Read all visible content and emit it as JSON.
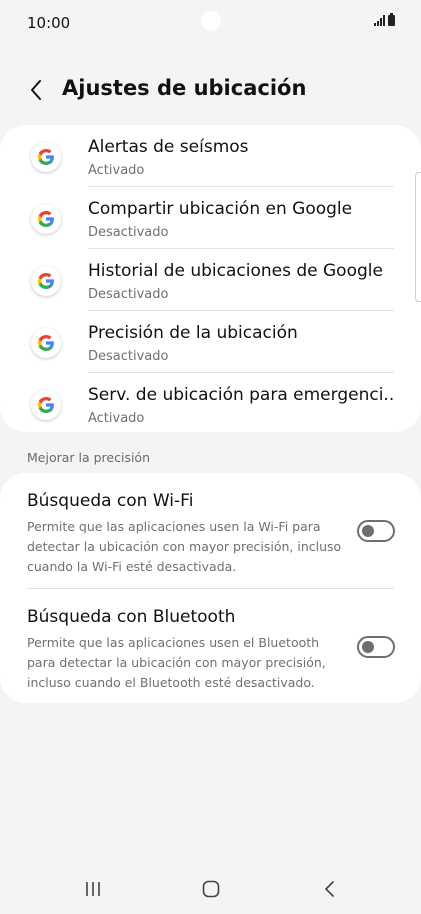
{
  "status_bar": {
    "time": "10:00"
  },
  "header": {
    "title": "Ajustes de ubicación"
  },
  "apps": [
    {
      "title": "Alertas de seísmos",
      "status": "Activado"
    },
    {
      "title": "Compartir ubicación en Google",
      "status": "Desactivado"
    },
    {
      "title": "Historial de ubicaciones de Google",
      "status": "Desactivado"
    },
    {
      "title": "Precisión de la ubicación",
      "status": "Desactivado"
    },
    {
      "title": "Serv. de ubicación para emergenci..",
      "status": "Activado"
    }
  ],
  "section": {
    "label": "Mejorar la precisión"
  },
  "settings": [
    {
      "title": "Búsqueda con Wi-Fi",
      "description": "Permite que las aplicaciones usen la Wi-Fi para detectar la ubicación con mayor precisión, incluso cuando la Wi-Fi esté desactivada.",
      "enabled": false
    },
    {
      "title": "Búsqueda con Bluetooth",
      "description": "Permite que las aplicaciones usen el Bluetooth para detectar la ubicación con mayor precisión, incluso cuando el Bluetooth esté desactivado.",
      "enabled": false
    }
  ],
  "icons": {
    "back": "chevron-left-icon",
    "app": "google-icon",
    "recents": "recents-icon",
    "home": "home-icon",
    "nav_back": "back-icon"
  },
  "colors": {
    "background": "#f4f4f6",
    "card": "#ffffff",
    "toggle_off": "#6e6e6e",
    "google_blue": "#4285F4",
    "google_red": "#EA4335",
    "google_yellow": "#FBBC05",
    "google_green": "#34A853"
  }
}
